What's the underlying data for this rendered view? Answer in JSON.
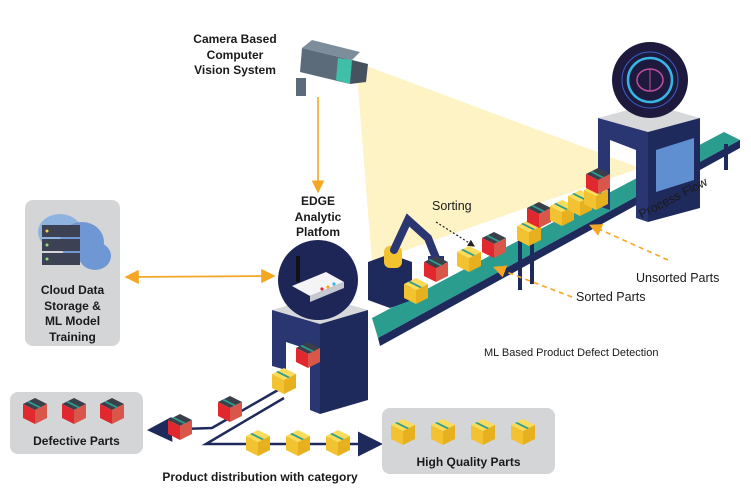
{
  "labels": {
    "camera": [
      "Camera Based",
      "Computer",
      "Vision System"
    ],
    "edge": [
      "EDGE",
      "Analytic",
      "Platfom"
    ],
    "cloud": [
      "Cloud Data",
      "Storage &",
      "ML Model",
      "Training"
    ],
    "sorting": "Sorting",
    "unsorted": "Unsorted Parts",
    "sorted": "Sorted Parts",
    "process_flow": "Process Flow",
    "ml_detection": "ML Based Product Defect Detection",
    "defective": "Defective Parts",
    "high_quality": "High Quality Parts",
    "distribution": "Product distribution with category"
  },
  "colors": {
    "navy": "#1f2a5c",
    "teal": "#2a9d8f",
    "orange_arrow": "#f5a623",
    "beam": "#fdf3c4",
    "panel_gray": "#d4d5d7",
    "defective_red": "#e0282e",
    "good_yellow": "#f7cf3a"
  },
  "icons": [
    "camera-icon",
    "router-icon",
    "cloud-server-icon",
    "brain-ai-icon",
    "robot-arm-icon",
    "box-icon"
  ]
}
